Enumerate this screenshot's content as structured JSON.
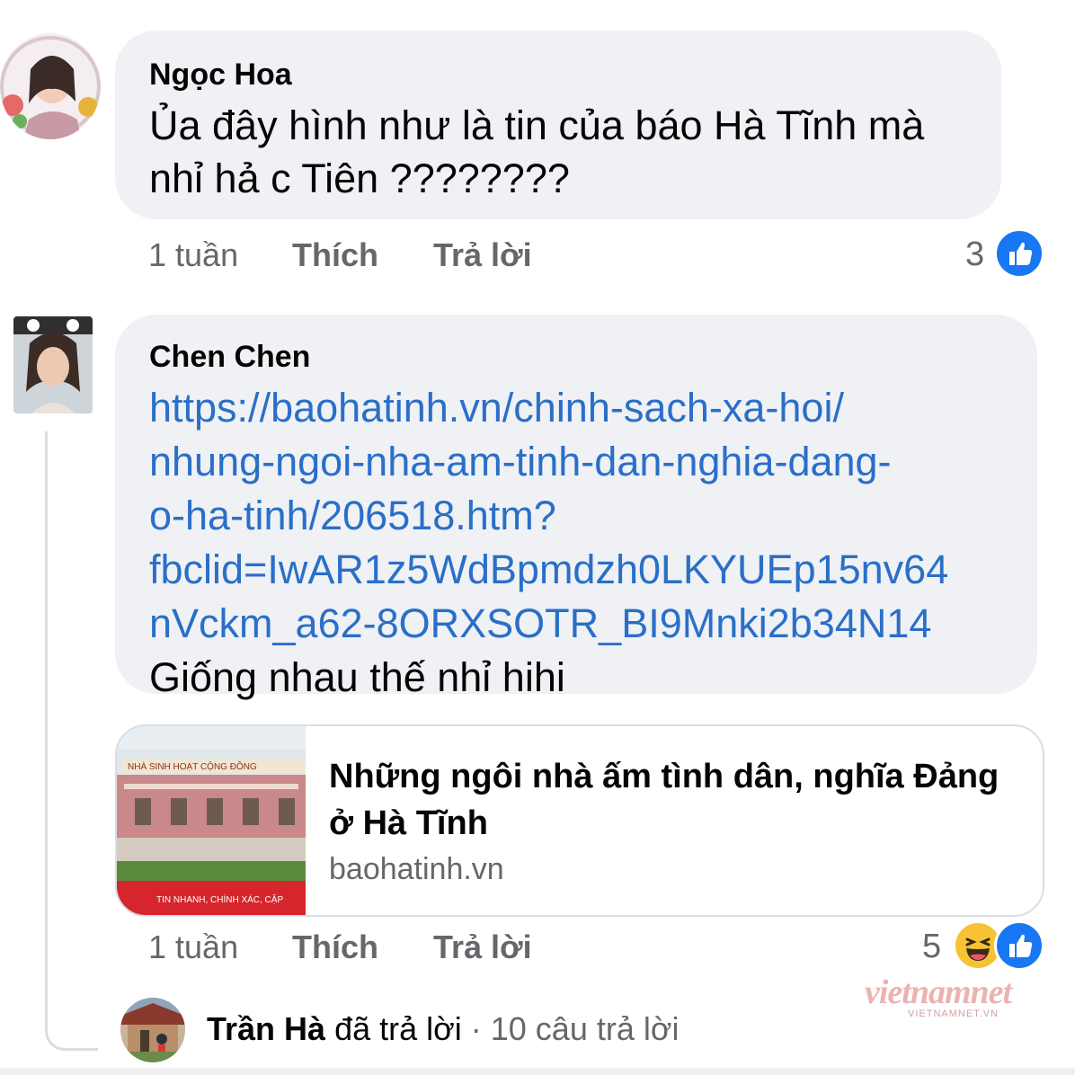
{
  "comments": [
    {
      "author": "Ngọc Hoa",
      "text": "Ủa đây hình như là tin của báo Hà Tĩnh mà nhỉ hả c Tiên ????????",
      "time": "1 tuần",
      "like_label": "Thích",
      "reply_label": "Trả lời",
      "reaction_count": "3",
      "reactions": [
        "like-icon"
      ]
    },
    {
      "author": "Chen Chen",
      "link_lines": [
        "https://baohatinh.vn/chinh-sach-xa-hoi/",
        "nhung-ngoi-nha-am-tinh-dan-nghia-dang-",
        "o-ha-tinh/206518.htm?",
        "fbclid=IwAR1z5WdBpmdzh0LKYUEp15nv64",
        "nVckm_a62-8ORXSOTR_BI9Mnki2b34N14"
      ],
      "text": "Giống nhau thế nhỉ hihi",
      "preview": {
        "title": "Những ngôi nhà ấm tình dân, nghĩa Đảng ở Hà Tĩnh",
        "domain": "baohatinh.vn",
        "image_banner": "NHÀ SINH HOẠT CỘNG ĐỒNG",
        "image_footer": "TIN NHANH, CHÍNH XÁC, CẬP"
      },
      "time": "1 tuần",
      "like_label": "Thích",
      "reply_label": "Trả lời",
      "reaction_count": "5",
      "reactions": [
        "haha-icon",
        "like-icon"
      ]
    }
  ],
  "replies_summary": {
    "author": "Trần Hà",
    "action": "đã trả lời",
    "separator": "·",
    "count_text": "10 câu trả lời"
  },
  "watermark": {
    "logo": "vietnamnet",
    "sub": "VIETNAMNET.VN"
  },
  "colors": {
    "bubble": "#eff1f4",
    "link": "#2a6fc8",
    "meta": "#65676b",
    "like": "#1877f2",
    "haha": "#f7c335"
  }
}
